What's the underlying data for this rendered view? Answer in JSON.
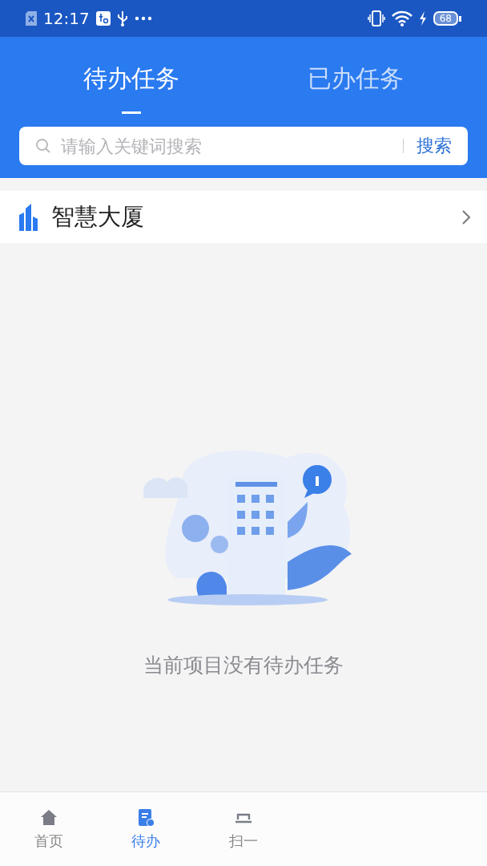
{
  "status_bar": {
    "time": "12:17",
    "battery": "68",
    "charging": true
  },
  "tabs": [
    {
      "label": "待办任务",
      "selected": true
    },
    {
      "label": "已办任务",
      "selected": false
    }
  ],
  "search": {
    "placeholder": "请输入关键词搜索",
    "button": "搜索"
  },
  "project": {
    "name": "智慧大厦"
  },
  "empty_state": {
    "message": "当前项目没有待办任务"
  },
  "bottom_nav": [
    {
      "label": "首页",
      "kind": "home",
      "selected": false
    },
    {
      "label": "待办",
      "kind": "todo",
      "selected": true
    },
    {
      "label": "扫一",
      "kind": "scan",
      "selected": false
    }
  ]
}
